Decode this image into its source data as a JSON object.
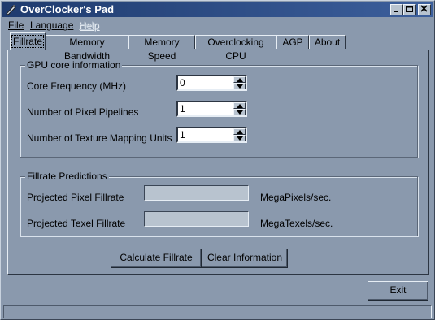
{
  "window": {
    "title": "OverClocker's Pad",
    "buttons": [
      "minimize",
      "maximize",
      "close"
    ]
  },
  "menu": [
    {
      "label": "File",
      "enabled": true
    },
    {
      "label": "Language",
      "enabled": true
    },
    {
      "label": "Help",
      "enabled": false
    }
  ],
  "tabs": [
    {
      "label": "Fillrate",
      "active": true
    },
    {
      "label": "Memory Bandwidth",
      "active": false
    },
    {
      "label": "Memory Speed",
      "active": false
    },
    {
      "label": "Overclocking CPU",
      "active": false
    },
    {
      "label": "AGP",
      "active": false
    },
    {
      "label": "About",
      "active": false
    }
  ],
  "gpu_group": {
    "title": "GPU core information",
    "fields": [
      {
        "label": "Core Frequency (MHz)",
        "value": "0"
      },
      {
        "label": "Number of Pixel Pipelines",
        "value": "1"
      },
      {
        "label": "Number of Texture Mapping Units",
        "value": "1"
      }
    ]
  },
  "predictions_group": {
    "title": "Fillrate Predictions",
    "rows": [
      {
        "label": "Projected Pixel Fillrate",
        "value": "",
        "unit": "MegaPixels/sec."
      },
      {
        "label": "Projected Texel Fillrate",
        "value": "",
        "unit": "MegaTexels/sec."
      }
    ]
  },
  "actions": {
    "calculate": "Calculate Fillrate",
    "clear": "Clear Information",
    "exit": "Exit"
  },
  "status_bar": ""
}
